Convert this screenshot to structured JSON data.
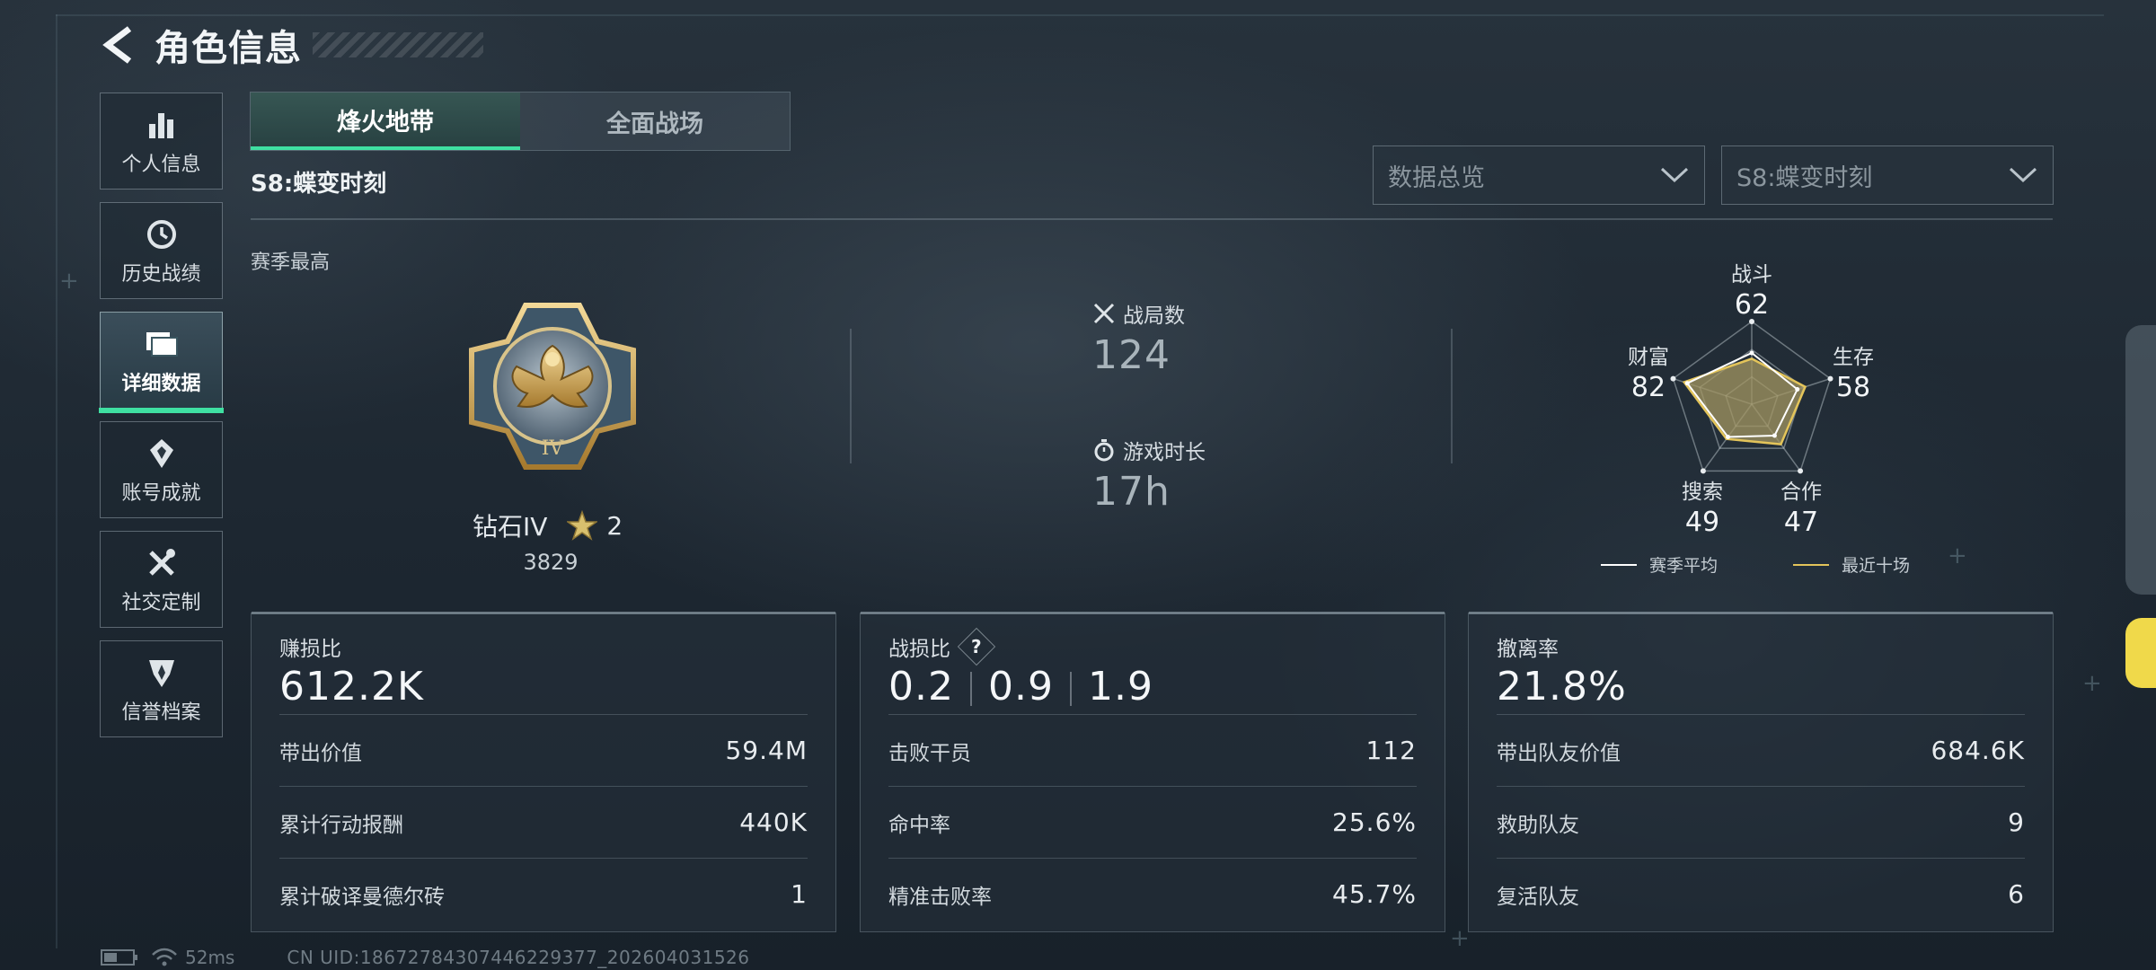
{
  "header": {
    "title": "角色信息"
  },
  "sidebar": {
    "items": [
      {
        "label": "个人信息",
        "icon": "bar-chart-icon"
      },
      {
        "label": "历史战绩",
        "icon": "history-icon"
      },
      {
        "label": "详细数据",
        "icon": "folder-icon",
        "active": true
      },
      {
        "label": "账号成就",
        "icon": "achievement-icon"
      },
      {
        "label": "社交定制",
        "icon": "tools-icon"
      },
      {
        "label": "信誉档案",
        "icon": "badge-icon"
      }
    ]
  },
  "tabs": [
    {
      "label": "烽火地带",
      "active": true
    },
    {
      "label": "全面战场",
      "active": false
    }
  ],
  "season_name": "S8:蝶变时刻",
  "dropdowns": {
    "data_scope": {
      "value": "数据总览"
    },
    "season": {
      "value": "S8:蝶变时刻"
    }
  },
  "season_high": {
    "label": "赛季最高",
    "rank": "钻石IV",
    "stars": "2",
    "score": "3829"
  },
  "stats": {
    "matches_label": "战局数",
    "matches_value": "124",
    "playtime_label": "游戏时长",
    "playtime_value": "17h"
  },
  "radar": {
    "axes": [
      {
        "label": "战斗",
        "value": "62"
      },
      {
        "label": "生存",
        "value": "58"
      },
      {
        "label": "合作",
        "value": "47"
      },
      {
        "label": "搜索",
        "value": "49"
      },
      {
        "label": "财富",
        "value": "82"
      }
    ],
    "legend_season": "赛季平均",
    "legend_recent": "最近十场",
    "season_values": [
      62,
      58,
      47,
      49,
      82
    ],
    "recent_values": [
      55,
      68,
      60,
      52,
      86
    ],
    "colors": {
      "season": "#ffffff",
      "recent": "#e3c45a",
      "fill": "#a39561"
    }
  },
  "cards": [
    {
      "title": "赚损比",
      "big": "612.2K",
      "rows": [
        {
          "label": "带出价值",
          "value": "59.4M"
        },
        {
          "label": "累计行动报酬",
          "value": "440K"
        },
        {
          "label": "累计破译曼德尔砖",
          "value": "1"
        }
      ]
    },
    {
      "title": "战损比",
      "big_parts": [
        "0.2",
        "0.9",
        "1.9"
      ],
      "help": "?",
      "rows": [
        {
          "label": "击败干员",
          "value": "112"
        },
        {
          "label": "命中率",
          "value": "25.6%"
        },
        {
          "label": "精准击败率",
          "value": "45.7%"
        }
      ]
    },
    {
      "title": "撤离率",
      "big": "21.8%",
      "rows": [
        {
          "label": "带出队友价值",
          "value": "684.6K"
        },
        {
          "label": "救助队友",
          "value": "9"
        },
        {
          "label": "复活队友",
          "value": "6"
        }
      ]
    }
  ],
  "footer": {
    "ping": "52ms",
    "uid": "CN UID:18672784307446229377_202604031526"
  },
  "accent_color": "#3fe0a2"
}
